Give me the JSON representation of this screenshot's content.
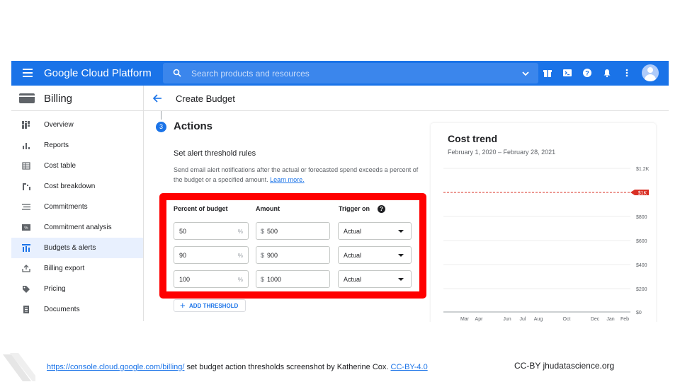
{
  "topbar": {
    "app_name": "Google Cloud Platform",
    "search_placeholder": "Search products and resources",
    "accent_color": "#1a73e8"
  },
  "sidebar": {
    "title": "Billing",
    "items": [
      {
        "label": "Overview",
        "icon": "overview-icon"
      },
      {
        "label": "Reports",
        "icon": "reports-icon"
      },
      {
        "label": "Cost table",
        "icon": "cost-table-icon"
      },
      {
        "label": "Cost breakdown",
        "icon": "cost-breakdown-icon"
      },
      {
        "label": "Commitments",
        "icon": "commitments-icon"
      },
      {
        "label": "Commitment analysis",
        "icon": "commitment-analysis-icon"
      },
      {
        "label": "Budgets & alerts",
        "icon": "budgets-icon",
        "active": true
      },
      {
        "label": "Billing export",
        "icon": "export-icon"
      },
      {
        "label": "Pricing",
        "icon": "pricing-tag-icon"
      },
      {
        "label": "Documents",
        "icon": "documents-icon"
      }
    ]
  },
  "header": {
    "title": "Create Budget"
  },
  "actions": {
    "step_number": "3",
    "title": "Actions",
    "rules_title": "Set alert threshold rules",
    "description_line1": "Send email alert notifications after the actual or forecasted spend exceeds a percent of",
    "description_line2": "the budget or a specified amount.",
    "learn_more": "Learn more.",
    "columns": {
      "percent": "Percent of budget",
      "amount": "Amount",
      "trigger": "Trigger on"
    },
    "rows": [
      {
        "percent": "50",
        "percent_suffix": "%",
        "currency": "$",
        "amount": "500",
        "trigger": "Actual"
      },
      {
        "percent": "90",
        "percent_suffix": "%",
        "currency": "$",
        "amount": "900",
        "trigger": "Actual"
      },
      {
        "percent": "100",
        "percent_suffix": "%",
        "currency": "$",
        "amount": "1000",
        "trigger": "Actual"
      }
    ],
    "add_threshold": "ADD THRESHOLD",
    "highlight_color": "#ff0000"
  },
  "chart_data": {
    "type": "line",
    "title": "Cost trend",
    "subtitle": "February 1, 2020 – February 28, 2021",
    "x_ticks": [
      "Mar",
      "Apr",
      "Jun",
      "Jul",
      "Aug",
      "Oct",
      "Dec",
      "Jan",
      "Feb"
    ],
    "y_ticks": [
      "$1.2K",
      "$800",
      "$600",
      "$400",
      "$200",
      "$0"
    ],
    "ylim": [
      0,
      1200
    ],
    "budget_line": {
      "value": 1000,
      "label": "$1K",
      "color": "#d93025"
    },
    "series": [],
    "grid": true
  },
  "footer": {
    "caption_link": "https://console.cloud.google.com/billing/",
    "caption_text": " set budget action thresholds  screenshot by Katherine Cox. ",
    "license_link": "CC-BY-4.0",
    "credit": "CC-BY  jhudatascience.org"
  }
}
